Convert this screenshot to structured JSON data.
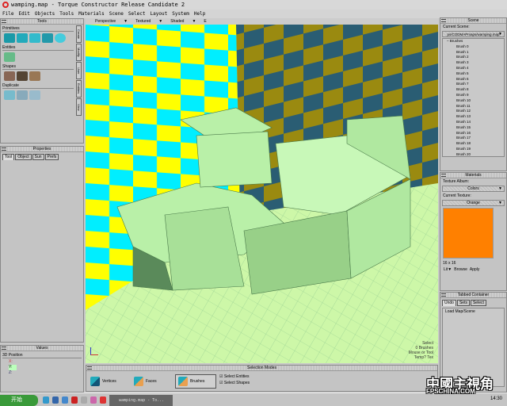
{
  "window": {
    "title": "wamping.map - Torque Constructor Release Candidate 2"
  },
  "menu": [
    "File",
    "Edit",
    "Objects",
    "Tools",
    "Materials",
    "Scene",
    "Select",
    "Layout",
    "System",
    "Help"
  ],
  "tools": {
    "title": "Tools",
    "sections": [
      "Primitives",
      "Entities",
      "Shapes",
      "Duplicate"
    ],
    "vtabs": [
      "Create",
      "Modify",
      "User",
      "Entities",
      "View"
    ]
  },
  "properties": {
    "title": "Properties",
    "tabs": [
      "Tool",
      "Object",
      "Sun",
      "Prefs"
    ]
  },
  "values": {
    "title": "Values",
    "section": "3D Position",
    "x": "X:",
    "y": "Y:",
    "z": "Z:"
  },
  "viewport": {
    "view": "Perspective",
    "texture": "Textured",
    "shade": "Shaded",
    "extra": "E",
    "hud": [
      "Select",
      "0 Brushes",
      "Mouse or Tool",
      "Temp? Tex"
    ]
  },
  "selection": {
    "title": "Selection Modes",
    "modes": [
      "Vertices",
      "Faces",
      "Brushes"
    ],
    "checks": [
      "Select Entities",
      "Select Shapes"
    ]
  },
  "scene": {
    "title": "Scene",
    "current_label": "Current Scene:",
    "current": "ps/CODMAPmaps/wamping.map",
    "root": "Brushes",
    "items": [
      "Brush 0",
      "Brush 1",
      "Brush 2",
      "Brush 3",
      "Brush 4",
      "Brush 5",
      "Brush 6",
      "Brush 7",
      "Brush 8",
      "Brush 9",
      "Brush 10",
      "Brush 11",
      "Brush 12",
      "Brush 13",
      "Brush 14",
      "Brush 15",
      "Brush 16",
      "Brush 17",
      "Brush 18",
      "Brush 19",
      "Brush 20"
    ]
  },
  "materials": {
    "title": "Materials",
    "album_label": "Texture Album:",
    "album": "Colors",
    "texture_label": "Current Texture:",
    "texture": "Orange",
    "swatch": "#ff8000",
    "size": "16 x 16",
    "buttons": [
      "Lit",
      "Browse",
      "Apply"
    ]
  },
  "tabbed": {
    "title": "Tabbed Container",
    "tabs": [
      "Undo",
      "Sets",
      "Select"
    ],
    "items": [
      "Load Map/Scene"
    ]
  },
  "taskbar": {
    "start": "开始",
    "task": "wamping.map - To...",
    "clock": "14:30"
  },
  "watermark": {
    "cn": "中國主視角",
    "en": "FPSCHINA.COM"
  }
}
